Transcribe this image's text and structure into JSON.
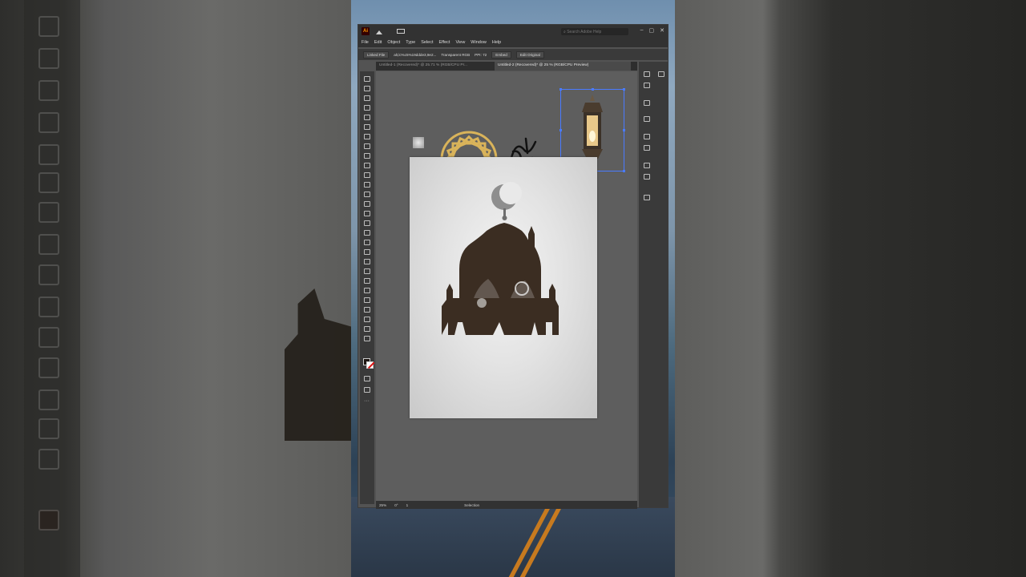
{
  "app": {
    "logo_text": "Ai",
    "search_placeholder": "Search Adobe Help",
    "window_buttons": [
      "–",
      "▢",
      "✕"
    ]
  },
  "menu": [
    "File",
    "Edit",
    "Object",
    "Type",
    "Select",
    "Effect",
    "View",
    "Window",
    "Help"
  ],
  "control_bar": {
    "linked_file": "Linked File",
    "file_name": "alt,lc%c5%19ddde3,9e2...",
    "color_mode": "Transparent RGB",
    "ppi": "PPI: 72",
    "embed": "Embed",
    "edit_original": "Edit Original"
  },
  "tabs": [
    {
      "label": "Untitled-1 (Recovered)* @ 25.71 % (RGB/CPU Pr...",
      "active": false
    },
    {
      "label": "Untitled-2 (Recovered)* @ 25 % (RGB/CPU Preview)",
      "active": true
    }
  ],
  "status": {
    "zoom": "25%",
    "rotation": "0°",
    "artboard_number": "1",
    "tool_name": "Selection"
  },
  "colors": {
    "ui_dark": "#323232",
    "ui_panel": "#3a3a3a",
    "canvas": "#5e5e5e",
    "gold_ornament": "#d9b35a",
    "mosque_cutout": "#3b2d22",
    "selection": "#4a7bff"
  },
  "icons": {
    "home": "home-icon",
    "workspace": "workspace-icon",
    "search": "search-icon",
    "minimize": "minimize-icon",
    "maximize": "maximize-icon",
    "close": "close-icon"
  }
}
